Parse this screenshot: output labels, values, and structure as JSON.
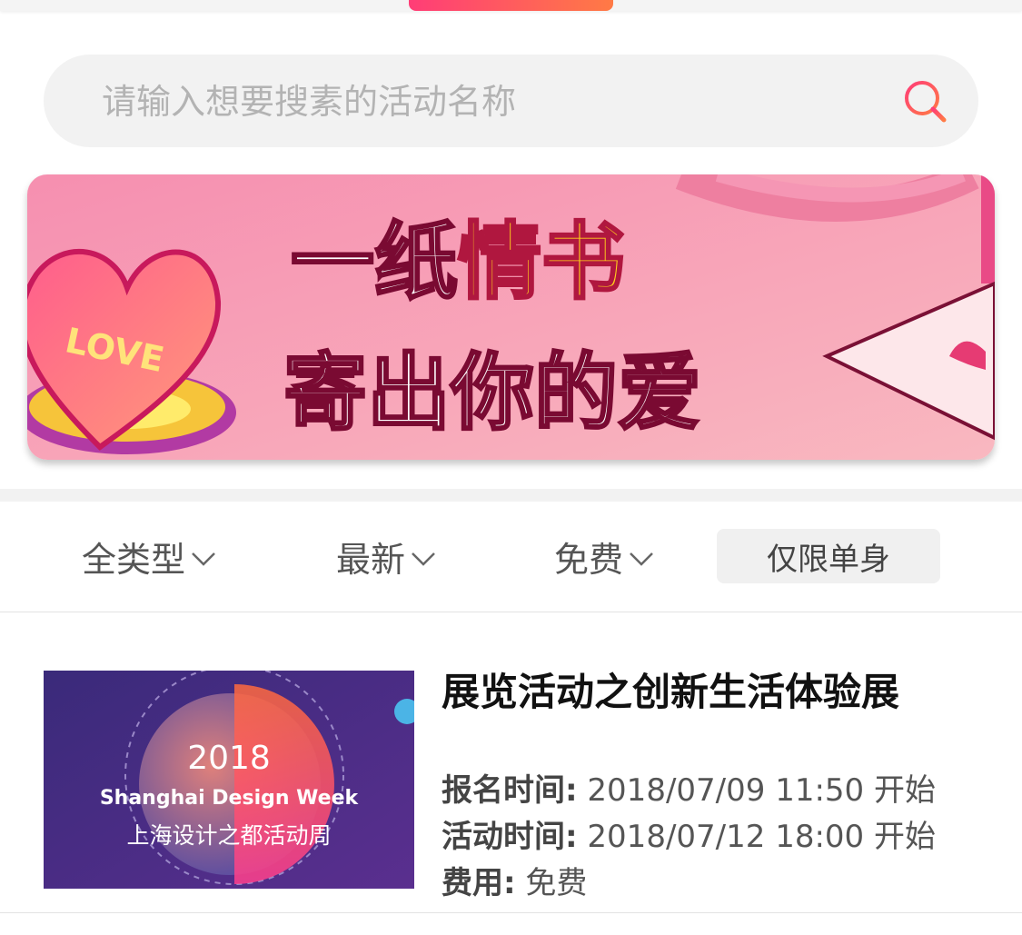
{
  "search": {
    "placeholder": "请输入想要搜素的活动名称",
    "icon": "search-icon"
  },
  "banner": {
    "line1_white": "一纸",
    "line1_yellow": "情书",
    "line2": "寄出你的爱",
    "heart_text": "LOVE"
  },
  "filters": {
    "type_label": "全类型",
    "sort_label": "最新",
    "fee_label": "免费",
    "single_label": "仅限单身"
  },
  "activities": [
    {
      "title": "展览活动之创新生活体验展",
      "image": {
        "year": "2018",
        "name_en": "Shanghai Design Week",
        "name_cn": "上海设计之都活动周"
      },
      "signup_label": "报名时间:",
      "signup_value": "2018/07/09 11:50 开始",
      "event_label": "活动时间:",
      "event_value": "2018/07/12 18:00 开始",
      "fee_label": "费用:",
      "fee_value": "免费"
    }
  ],
  "colors": {
    "accent_start": "#ff3d77",
    "accent_end": "#ff7a45",
    "banner_bg": "#f7a9b8"
  }
}
